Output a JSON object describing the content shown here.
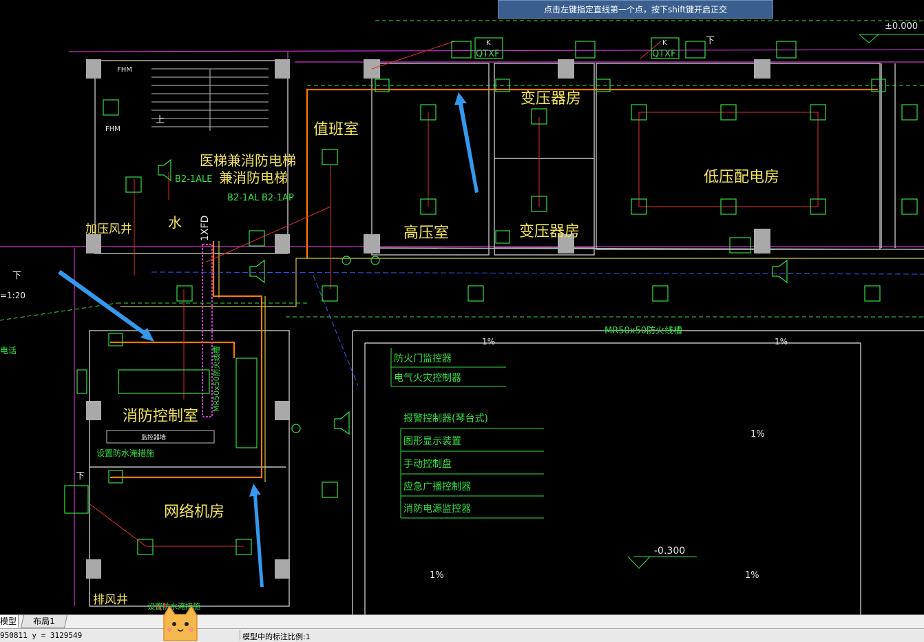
{
  "tooltip": "点击左键指定直线第一个点，按下shift键开启正交",
  "rooms": {
    "duty_room": "值班室",
    "transformer_room_1": "变压器房",
    "transformer_room_2": "变压器房",
    "low_voltage_room": "低压配电房",
    "high_voltage_room": "高压室",
    "fire_control_room": "消防控制室",
    "network_room": "网络机房",
    "pressurized_shaft": "加压风井",
    "exhaust_shaft": "排风井",
    "medical_elevator": "医梯兼消防电梯",
    "fire_elevator": "兼消防电梯",
    "water": "水"
  },
  "labels": {
    "elevation_top": "±0.000",
    "elevation_bottom": "-0.300",
    "cable_tray": "MR50x50防火线槽",
    "cable_tray_vertical": "MR50x50防火线槽",
    "slope": "1%",
    "panel_b2_1ale": "B2-1ALE",
    "panel_b2_1al": "B2-1AL",
    "panel_b2_1ap": "B2-1AP",
    "fhm": "FHM",
    "qtxf": "QTXF",
    "k": "K",
    "down": "下",
    "up": "上",
    "ratio": "=1:20",
    "phone": "电话",
    "monitor": "监控器墙",
    "waterproof_1": "设置防水淹措施",
    "waterproof_2": "设置防水淹措施",
    "ixfd": "1XFD"
  },
  "legend": {
    "group1": [
      "防火门监控器",
      "电气火灾控制器"
    ],
    "header": "报警控制器(琴台式)",
    "group2": [
      "图形显示装置",
      "手动控制盘",
      "应急广播控制器",
      "消防电源监控器"
    ]
  },
  "tabs": [
    "模型",
    "布局1"
  ],
  "status": {
    "coord": "950811 y = 3129549",
    "scale": "模型中的标注比例:1"
  },
  "colors": {
    "background": "#000000",
    "wall": "#bfbfbf",
    "symbol_green": "#33e044",
    "text_yellow": "#f2e35a",
    "cable_orange": "#ff7a00",
    "magenta_line": "#cc33cc",
    "arrow_blue": "#3399ee",
    "tooltip_bg": "#3a5f8f"
  }
}
